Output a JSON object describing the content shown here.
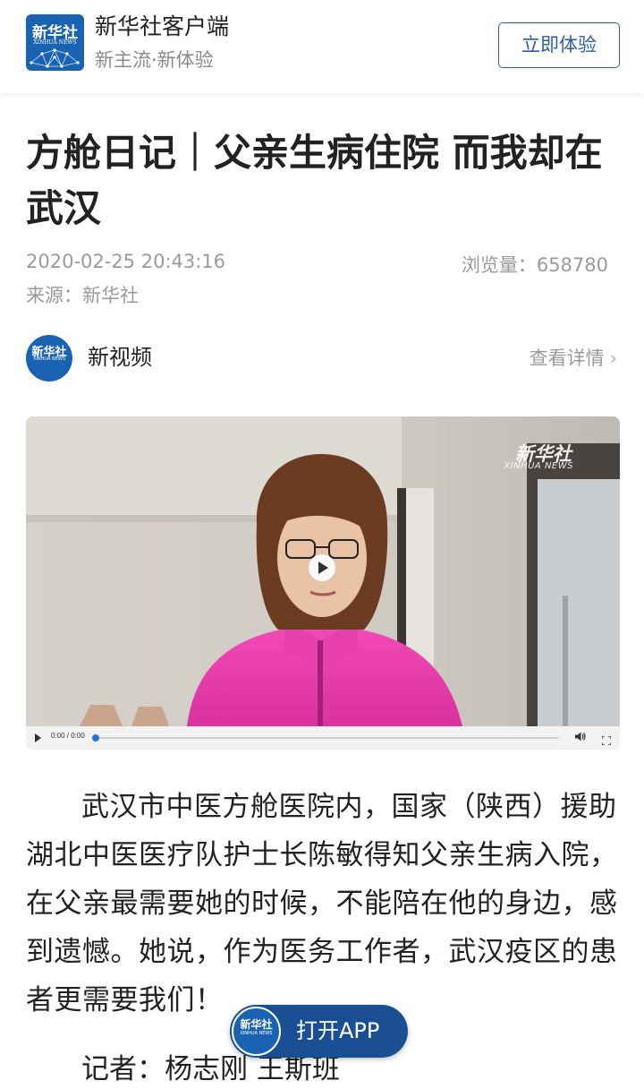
{
  "app_bar": {
    "logo_text": "新华社",
    "logo_sub": "XINHUA NEWS",
    "name": "新华社客户端",
    "slogan": "新主流·新体验",
    "try_button": "立即体验"
  },
  "article": {
    "title": "方舱日记｜父亲生病住院 而我却在武汉",
    "date": "2020-02-25 20:43:16",
    "views": "浏览量：658780",
    "source": "来源：新华社"
  },
  "channel": {
    "avatar_text": "新华社",
    "avatar_sub": "XINHUA NEWS",
    "name": "新视频",
    "details_label": "查看详情"
  },
  "video": {
    "watermark_main": "新华社",
    "watermark_sub": "XINHUA NEWS",
    "time": "0:00 / 0:00",
    "progress": 0
  },
  "body": {
    "paragraph": "武汉市中医方舱医院内，国家（陕西）援助湖北中医医疗队护士长陈敏得知父亲生病入院，在父亲最需要她的时候，不能陪在他的身边，感到遗憾。她说，作为医务工作者，武汉疫区的患者更需要我们！",
    "reporter": "记者：杨志刚 王斯班"
  },
  "open_app": {
    "logo_text": "新华社",
    "logo_sub": "XINHUA NEWS",
    "label": "打开APP"
  },
  "colors": {
    "brand_blue": "#1a63b3",
    "button_border": "#2d5da8",
    "open_app_bg": "#1b4f94",
    "muted_text": "#9a9a9a"
  },
  "icons": [
    "xinhua-logo-icon",
    "chevron-right-icon",
    "play-icon",
    "volume-icon",
    "fullscreen-icon"
  ]
}
